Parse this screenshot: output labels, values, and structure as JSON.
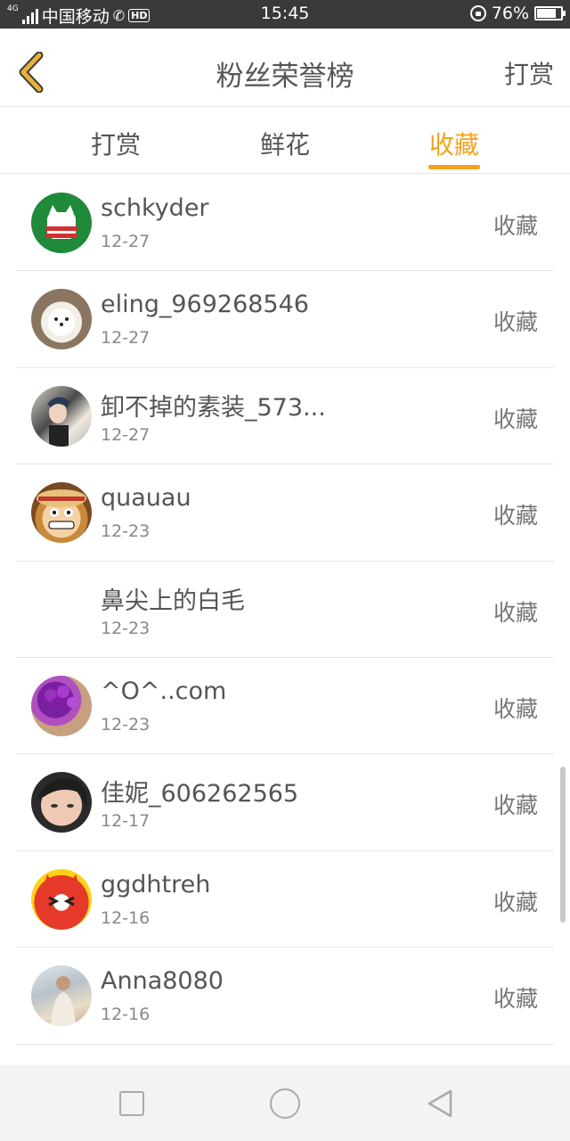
{
  "status_bar": {
    "network_tag": "4G",
    "carrier": "中国移动",
    "hd_label": "HD",
    "time": "15:45",
    "battery": "76%",
    "battery_level": 0.76
  },
  "header": {
    "title": "粉丝荣誉榜",
    "right_action": "打赏",
    "back_icon": "chevron-left-icon",
    "back_color": "#e8b13a"
  },
  "tabs": [
    {
      "label": "打赏",
      "active": false
    },
    {
      "label": "鲜花",
      "active": false
    },
    {
      "label": "收藏",
      "active": true
    }
  ],
  "accent_color": "#f4a21a",
  "list": [
    {
      "name": "schkyder",
      "date": "12-27",
      "action": "收藏"
    },
    {
      "name": "eling_969268546",
      "date": "12-27",
      "action": "收藏"
    },
    {
      "name": "卸不掉的素装_573...",
      "date": "12-27",
      "action": "收藏"
    },
    {
      "name": "quauau",
      "date": "12-23",
      "action": "收藏"
    },
    {
      "name": "鼻尖上的白毛",
      "date": "12-23",
      "action": "收藏"
    },
    {
      "name": "^O^..com",
      "date": "12-23",
      "action": "收藏"
    },
    {
      "name": "佳妮_606262565",
      "date": "12-17",
      "action": "收藏"
    },
    {
      "name": "ggdhtreh",
      "date": "12-16",
      "action": "收藏"
    },
    {
      "name": "Anna8080",
      "date": "12-16",
      "action": "收藏"
    }
  ],
  "navbar": {
    "icons": [
      "recents-square-icon",
      "home-circle-icon",
      "back-triangle-icon"
    ]
  }
}
